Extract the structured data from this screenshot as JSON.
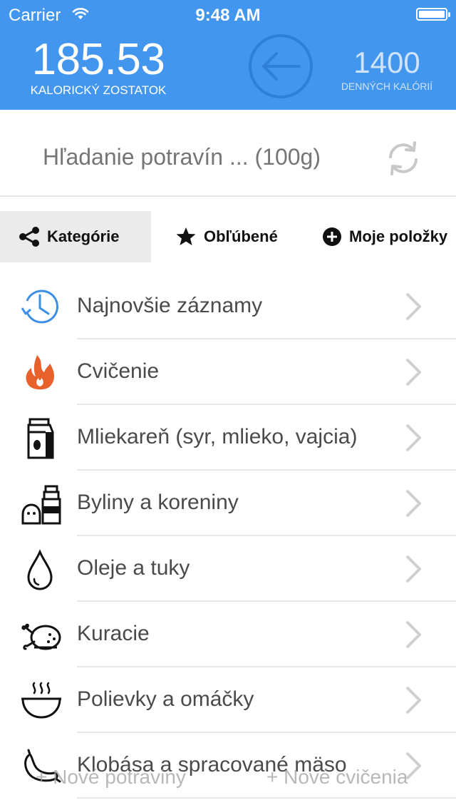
{
  "status": {
    "carrier": "Carrier",
    "time": "9:48 AM"
  },
  "header": {
    "remaining_value": "185.53",
    "remaining_label": "KALORICKÝ ZOSTATOK",
    "daily_value": "1400",
    "daily_label": "DENNÝCH KALÓRIÍ"
  },
  "search": {
    "placeholder": "Hľadanie potravín ... (100g)"
  },
  "tabs": [
    {
      "label": "Kategórie",
      "icon": "share-icon",
      "active": true
    },
    {
      "label": "Obľúbené",
      "icon": "star-icon",
      "active": false
    },
    {
      "label": "Moje položky",
      "icon": "plus-circle-icon",
      "active": false
    }
  ],
  "categories": [
    {
      "label": "Najnovšie záznamy",
      "icon": "clock-history-icon"
    },
    {
      "label": "Cvičenie",
      "icon": "flame-icon"
    },
    {
      "label": "Mliekareň (syr, mlieko, vajcia)",
      "icon": "milk-carton-icon"
    },
    {
      "label": "Byliny a koreniny",
      "icon": "salt-pepper-icon"
    },
    {
      "label": "Oleje a tuky",
      "icon": "drop-icon"
    },
    {
      "label": "Kuracie",
      "icon": "chicken-icon"
    },
    {
      "label": "Polievky a omáčky",
      "icon": "soup-bowl-icon"
    },
    {
      "label": "Klobása a spracované mäso",
      "icon": "sausage-icon"
    }
  ],
  "bottom": {
    "new_food": "+ Nové potraviny",
    "new_exercise": "+ Nové cvičenia"
  },
  "colors": {
    "header": "#4396ee",
    "flame": "#e8602c",
    "clock": "#3b8fe6"
  }
}
